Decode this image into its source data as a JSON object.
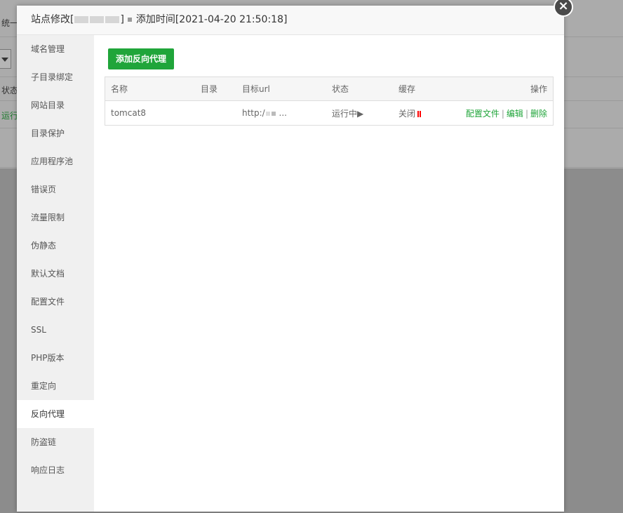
{
  "background": {
    "top_text": "统一",
    "status_label": "状态",
    "running_text": "运行"
  },
  "modal": {
    "title_prefix": "站点修改[",
    "title_suffix": "]",
    "added_time": "添加时间[2021-04-20 21:50:18]",
    "close_icon": "×"
  },
  "sidebar": {
    "items": [
      {
        "label": "域名管理"
      },
      {
        "label": "子目录绑定"
      },
      {
        "label": "网站目录"
      },
      {
        "label": "目录保护"
      },
      {
        "label": "应用程序池"
      },
      {
        "label": "错误页"
      },
      {
        "label": "流量限制"
      },
      {
        "label": "伪静态"
      },
      {
        "label": "默认文档"
      },
      {
        "label": "配置文件"
      },
      {
        "label": "SSL"
      },
      {
        "label": "PHP版本"
      },
      {
        "label": "重定向"
      },
      {
        "label": "反向代理"
      },
      {
        "label": "防盗链"
      },
      {
        "label": "响应日志"
      }
    ],
    "active_index": 13
  },
  "main": {
    "add_button": "添加反向代理",
    "table": {
      "headers": {
        "name": "名称",
        "dir": "目录",
        "target": "目标url",
        "status": "状态",
        "cache": "缓存",
        "ops": "操作"
      },
      "rows": [
        {
          "name": "tomcat8",
          "dir": "",
          "target": "http:/",
          "target_more": "...",
          "status": "运行中",
          "status_icon": "▶",
          "cache": "关闭",
          "op_config": "配置文件",
          "op_edit": "编辑",
          "op_delete": "删除"
        }
      ]
    }
  },
  "colors": {
    "accent": "#20a53a",
    "danger": "#ff0000"
  }
}
